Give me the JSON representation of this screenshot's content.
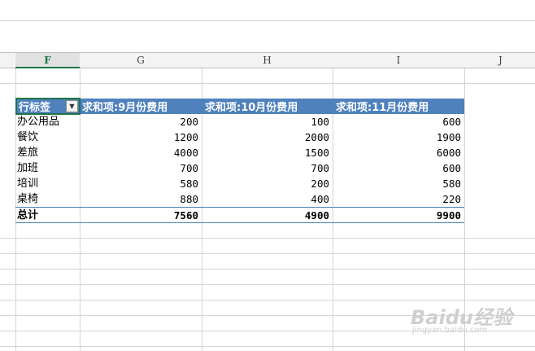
{
  "columns": [
    "F",
    "G",
    "H",
    "I",
    "J"
  ],
  "selected_column": "F",
  "pivot": {
    "headers": [
      "行标签",
      "求和项:9月份费用",
      "求和项:10月份费用",
      "求和项:11月份费用"
    ],
    "rows": [
      {
        "label": "办公用品",
        "values": [
          "200",
          "100",
          "600"
        ]
      },
      {
        "label": "餐饮",
        "values": [
          "1200",
          "2000",
          "1900"
        ]
      },
      {
        "label": "差旅",
        "values": [
          "4000",
          "1500",
          "6000"
        ]
      },
      {
        "label": "加班",
        "values": [
          "700",
          "700",
          "600"
        ]
      },
      {
        "label": "培训",
        "values": [
          "580",
          "200",
          "580"
        ]
      },
      {
        "label": "桌椅",
        "values": [
          "880",
          "400",
          "220"
        ]
      }
    ],
    "total": {
      "label": "总计",
      "values": [
        "7560",
        "4900",
        "9900"
      ]
    }
  },
  "watermark": {
    "main": "Baidu经验",
    "sub": "jingyan.baidu.com"
  },
  "colors": {
    "header_fill": "#4f81bd",
    "selected_col": "#217346"
  }
}
